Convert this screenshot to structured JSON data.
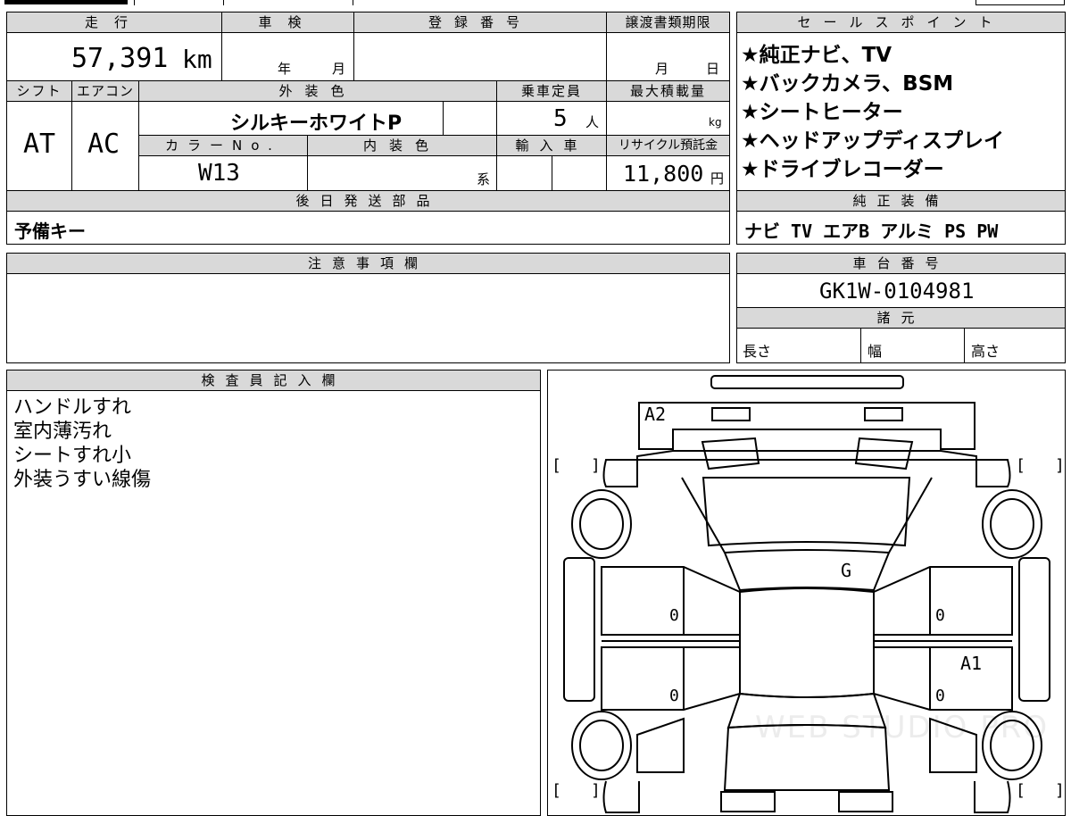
{
  "main": {
    "mileage_label": "走行",
    "mileage_value": "57,391",
    "mileage_unit": "km",
    "inspection_label": "車検",
    "year_unit": "年",
    "month_unit": "月",
    "registration_label": "登録番号",
    "transfer_deadline_label": "譲渡書類期限",
    "transfer_month": "月",
    "transfer_day": "日",
    "shift_label": "シフト",
    "shift_value": "AT",
    "aircon_label": "エアコン",
    "aircon_value": "AC",
    "exterior_color_label": "外装色",
    "exterior_color_value": "シルキーホワイトP",
    "capacity_label": "乗車定員",
    "capacity_value": "5",
    "capacity_unit": "人",
    "max_load_label": "最大積載量",
    "max_load_unit": "kg",
    "color_no_label": "カラーNo.",
    "color_no_value": "W13",
    "interior_color_label": "内装色",
    "interior_suffix": "系",
    "import_label": "輸入車",
    "recycle_label": "リサイクル預託金",
    "recycle_value": "11,800",
    "recycle_unit": "円",
    "later_parts_label": "後日発送部品",
    "later_parts_value": "予備キー"
  },
  "sales": {
    "label": "セールスポイント",
    "points": [
      "★純正ナビ、TV",
      "★バックカメラ、BSM",
      "★シートヒーター",
      "★ヘッドアップディスプレイ",
      "★ドライブレコーダー"
    ]
  },
  "equipment": {
    "label": "純正装備",
    "value": "ナビ TV エアB アルミ PS PW"
  },
  "notice": {
    "label": "注意事項欄",
    "value": ""
  },
  "chassis": {
    "label": "車台番号",
    "value": "GK1W-0104981"
  },
  "specs": {
    "label": "諸元",
    "length": "長さ",
    "width": "幅",
    "height": "高さ"
  },
  "inspector": {
    "label": "検査員記入欄",
    "notes": [
      "ハンドルすれ",
      "室内薄汚れ",
      "シートすれ小",
      "外装うすい線傷"
    ]
  },
  "diagram": {
    "marks": {
      "a2": "A2",
      "g": "G",
      "a1": "A1"
    },
    "zeros": [
      "0",
      "0",
      "0",
      "0"
    ],
    "brackets": [
      "[",
      "]",
      "[",
      "]",
      "[",
      "]",
      "[",
      "]"
    ],
    "watermark": "WEB STUDIO PRO"
  }
}
